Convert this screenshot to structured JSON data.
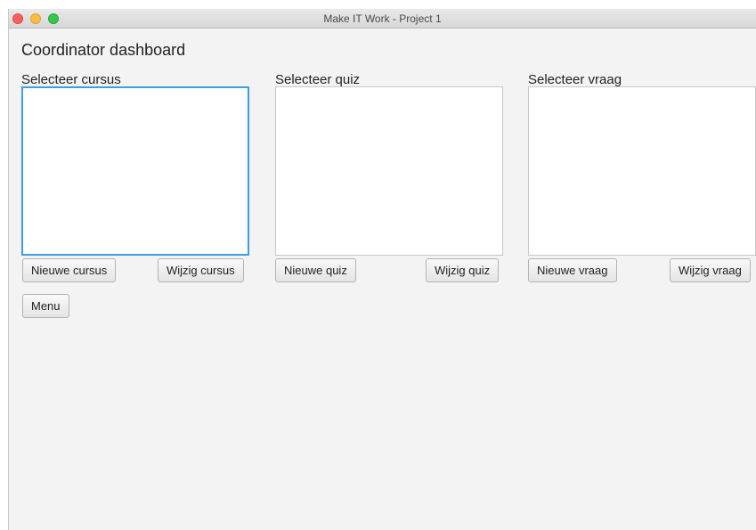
{
  "window": {
    "title": "Make IT Work - Project 1"
  },
  "page": {
    "heading": "Coordinator dashboard"
  },
  "columns": [
    {
      "label": "Selecteer cursus",
      "new_button": "Nieuwe cursus",
      "edit_button": "Wijzig cursus",
      "items": []
    },
    {
      "label": "Selecteer quiz",
      "new_button": "Nieuwe quiz",
      "edit_button": "Wijzig quiz",
      "items": []
    },
    {
      "label": "Selecteer vraag",
      "new_button": "Nieuwe vraag",
      "edit_button": "Wijzig vraag",
      "items": []
    }
  ],
  "menu_button": "Menu",
  "colors": {
    "focus_ring": "#3a9ee6",
    "window_bg": "#f3f3f3"
  }
}
